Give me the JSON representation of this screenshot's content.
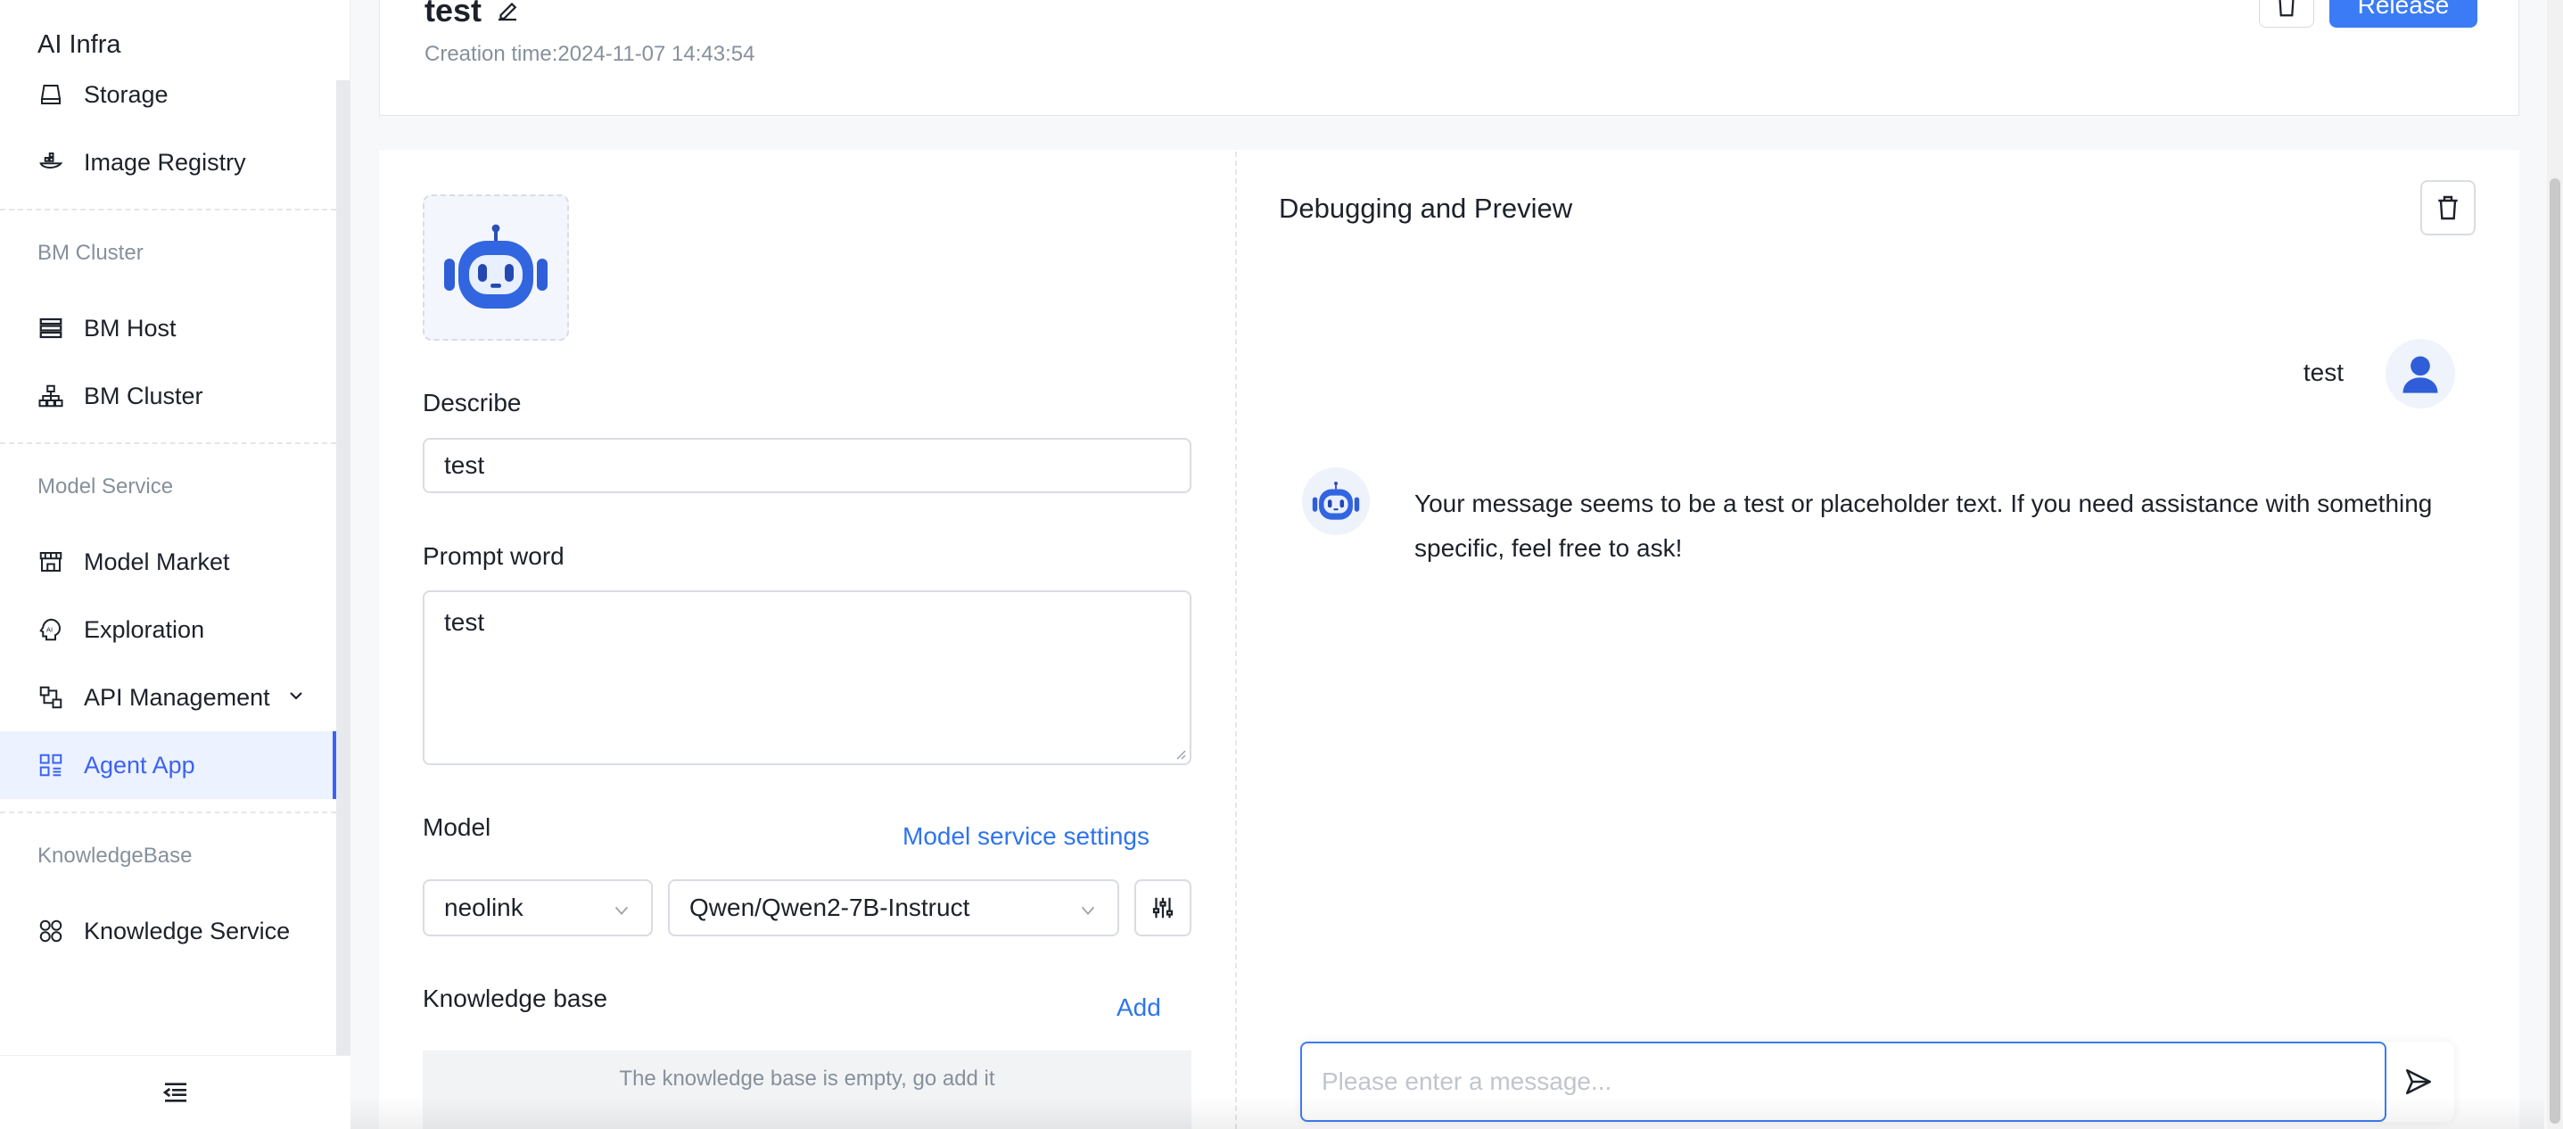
{
  "sidebar": {
    "brand": "AI Infra",
    "items": [
      {
        "label": "Storage",
        "icon": "storage-icon"
      },
      {
        "label": "Image Registry",
        "icon": "image-registry-icon"
      },
      {
        "label": "BM Host",
        "icon": "bm-host-icon"
      },
      {
        "label": "BM Cluster",
        "icon": "bm-cluster-icon"
      },
      {
        "label": "Model Market",
        "icon": "model-market-icon"
      },
      {
        "label": "Exploration",
        "icon": "ai-exploration-icon"
      },
      {
        "label": "API Management",
        "icon": "api-management-icon"
      },
      {
        "label": "Agent App",
        "icon": "agent-app-icon",
        "active": true
      },
      {
        "label": "Knowledge Service",
        "icon": "knowledge-service-icon"
      }
    ],
    "groups": {
      "bm_cluster": "BM Cluster",
      "model_service": "Model Service",
      "knowledge_base": "KnowledgeBase"
    }
  },
  "header": {
    "title": "test",
    "creation_time": "Creation time:2024-11-07 14:43:54",
    "release_label": "Release"
  },
  "config": {
    "describe_label": "Describe",
    "describe_value": "test",
    "prompt_label": "Prompt word",
    "prompt_value": "test",
    "model_label": "Model",
    "model_settings_link": "Model service settings",
    "provider_value": "neolink",
    "model_value": "Qwen/Qwen2-7B-Instruct",
    "knowledge_label": "Knowledge base",
    "knowledge_add": "Add",
    "knowledge_empty": "The knowledge base is empty, go add it"
  },
  "debug": {
    "title": "Debugging and Preview",
    "user_message": "test",
    "bot_message": "Your message seems to be a test or placeholder text. If you need assistance with something specific, feel free to ask!",
    "input_placeholder": "Please enter a message..."
  },
  "colors": {
    "accent": "#3b7cf6",
    "active_nav": "#3b63f2",
    "link": "#2e74ee"
  }
}
